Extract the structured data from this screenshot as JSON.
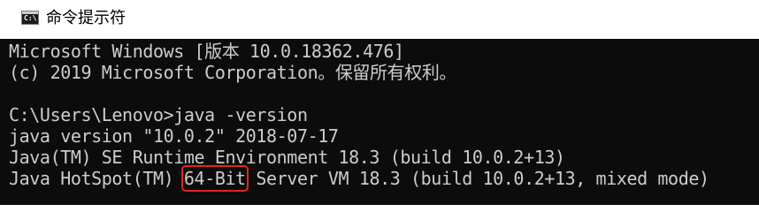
{
  "window": {
    "title": "命令提示符",
    "icon": "command-prompt-icon"
  },
  "console": {
    "lines": [
      "Microsoft Windows [版本 10.0.18362.476]",
      "(c) 2019 Microsoft Corporation。保留所有权利。",
      "",
      "C:\\Users\\Lenovo>java -version",
      "java version \"10.0.2\" 2018-07-17",
      "Java(TM) SE Runtime Environment 18.3 (build 10.0.2+13)"
    ],
    "last_line": {
      "prefix": "Java HotSpot(TM) ",
      "highlighted": "64-Bit",
      "suffix": " Server VM 18.3 (build 10.0.2+13, mixed mode)"
    }
  },
  "colors": {
    "console_background": "#0c0c0c",
    "console_text": "#cccccc",
    "highlight_box": "#e0261b",
    "titlebar_background": "#ffffff"
  }
}
